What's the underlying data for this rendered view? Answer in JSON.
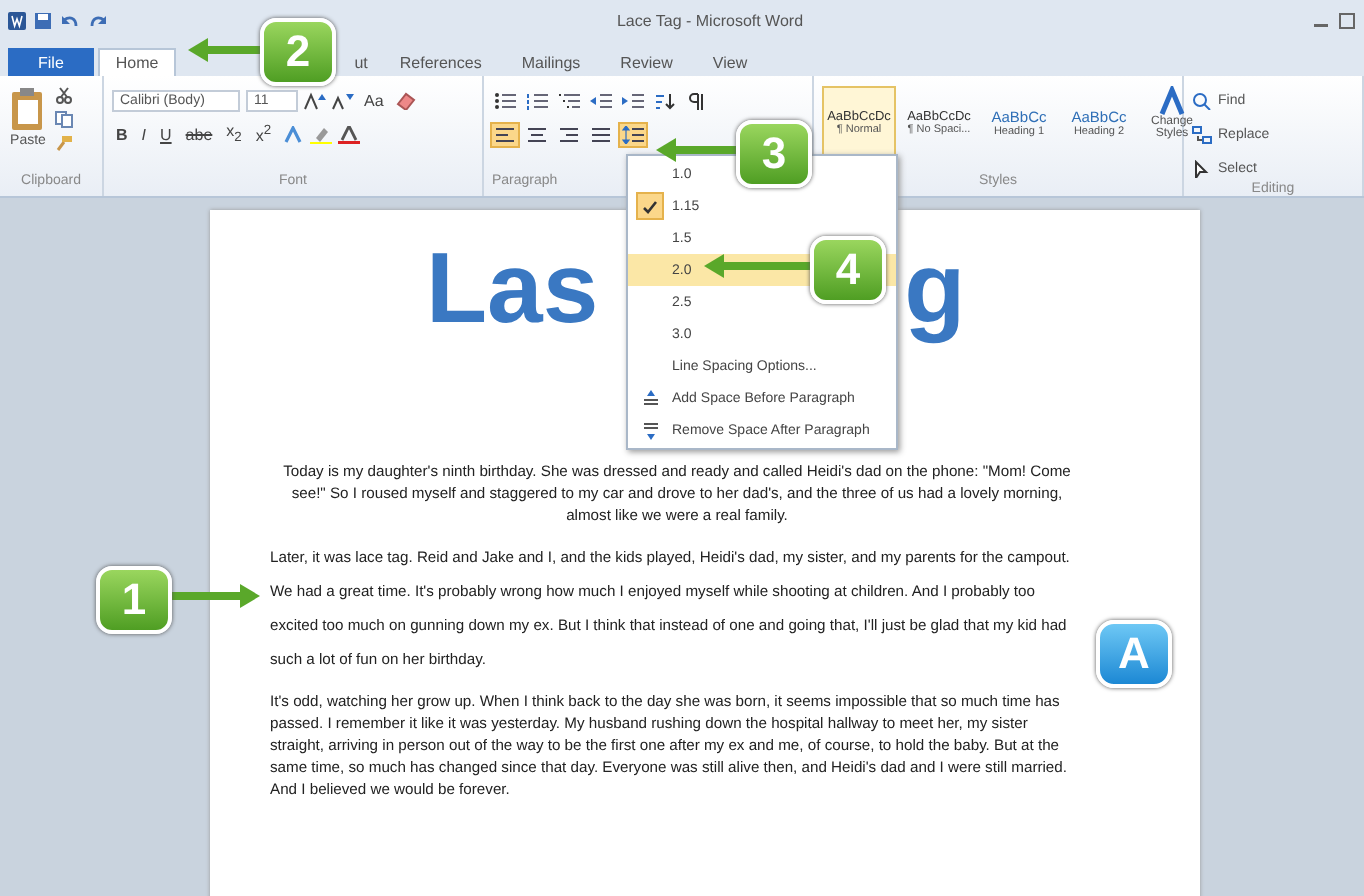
{
  "window": {
    "title": "Lace Tag - Microsoft Word"
  },
  "tabs": [
    {
      "label": "File",
      "kind": "file",
      "selected": false
    },
    {
      "label": "Home",
      "kind": "tab",
      "selected": true
    },
    {
      "label": "ut",
      "kind": "partial",
      "selected": false
    },
    {
      "label": "References",
      "kind": "tab",
      "selected": false
    },
    {
      "label": "Mailings",
      "kind": "tab",
      "selected": false
    },
    {
      "label": "Review",
      "kind": "tab",
      "selected": false
    },
    {
      "label": "View",
      "kind": "tab",
      "selected": false
    }
  ],
  "ribbon": {
    "paste": "Paste",
    "font_name": "Calibri (Body)",
    "font_size": "11",
    "case_button": "Aa",
    "format_buttons": [
      "B",
      "I",
      "U",
      "abe",
      "x$_{2}$",
      "x$^{2}$"
    ],
    "align_buttons": [
      {
        "kind": "left",
        "selected": true
      },
      {
        "kind": "center",
        "selected": false
      },
      {
        "kind": "right",
        "selected": false
      },
      {
        "kind": "justify",
        "selected": false
      }
    ],
    "line_spacing_open": true,
    "styles": [
      {
        "sample": "AaBbCcDc",
        "label": "¶ Normal",
        "kind": "body",
        "selected": true
      },
      {
        "sample": "AaBbCcDc",
        "label": "¶ No Spaci...",
        "kind": "body",
        "selected": false
      },
      {
        "sample": "AaBbCc",
        "label": "Heading 1",
        "kind": "heading",
        "selected": false
      },
      {
        "sample": "AaBbCc",
        "label": "Heading 2",
        "kind": "heading",
        "selected": false
      }
    ],
    "change_styles": "Change Styles",
    "editing": [
      "Find",
      "Replace",
      "Select"
    ],
    "groups": [
      "Clipboard",
      "Font",
      "Paragraph",
      "Styles",
      "Editing"
    ]
  },
  "line_spacing_menu": [
    {
      "label": "1.0",
      "kind": "value",
      "checked": false,
      "selected": false
    },
    {
      "label": "1.15",
      "kind": "value",
      "checked": true,
      "selected": false
    },
    {
      "label": "1.5",
      "kind": "value",
      "checked": false,
      "selected": false
    },
    {
      "label": "2.0",
      "kind": "value",
      "checked": false,
      "selected": true
    },
    {
      "label": "2.5",
      "kind": "value",
      "checked": false,
      "selected": false
    },
    {
      "label": "3.0",
      "kind": "value",
      "checked": false,
      "selected": false
    },
    {
      "label": "Line Spacing Options...",
      "kind": "command",
      "checked": false,
      "selected": false
    },
    {
      "label": "Add Space Before Paragraph",
      "kind": "add",
      "selected": false
    },
    {
      "label": "Remove Space After Paragraph",
      "kind": "remove",
      "selected": false
    }
  ],
  "document": {
    "heading_parts": [
      "Las",
      "g"
    ],
    "paragraphs": [
      {
        "kind": "centered",
        "text": "Today is my daughter's ninth birthday. She was dressed and ready and called Heidi's dad on the phone: \"Mom! Come see!\" So I roused myself and staggered to my car and drove to her dad's, and the three of us had a lovely morning, almost like we were a real family."
      },
      {
        "kind": "spaced",
        "text": "Later, it was lace tag. Reid and Jake and I, and the kids played, Heidi's dad, my sister, and my parents for the campout. We had a great time. It's probably wrong how much I enjoyed myself while shooting at children. And I probably too excited too much on gunning down my ex. But I think that instead of one and going that, I'll just be glad that my kid had such a lot of fun on her birthday."
      },
      {
        "kind": "plain",
        "text": "It's odd, watching her grow up. When I think back to the day she was born, it seems impossible that so much time has passed. I remember it like it was yesterday. My husband rushing down the hospital hallway to meet her, my sister straight, arriving in person out of the way to be the first one after my ex and me, of course, to hold the baby. But at the same time, so much has changed since that day. Everyone was still alive then, and Heidi's dad and I were still married. And I believed we would be forever."
      }
    ]
  },
  "callouts": [
    {
      "label": "2",
      "kind": "step"
    },
    {
      "label": "3",
      "kind": "step"
    },
    {
      "label": "4",
      "kind": "step"
    },
    {
      "label": "1",
      "kind": "step"
    },
    {
      "label": "A",
      "kind": "note"
    }
  ]
}
